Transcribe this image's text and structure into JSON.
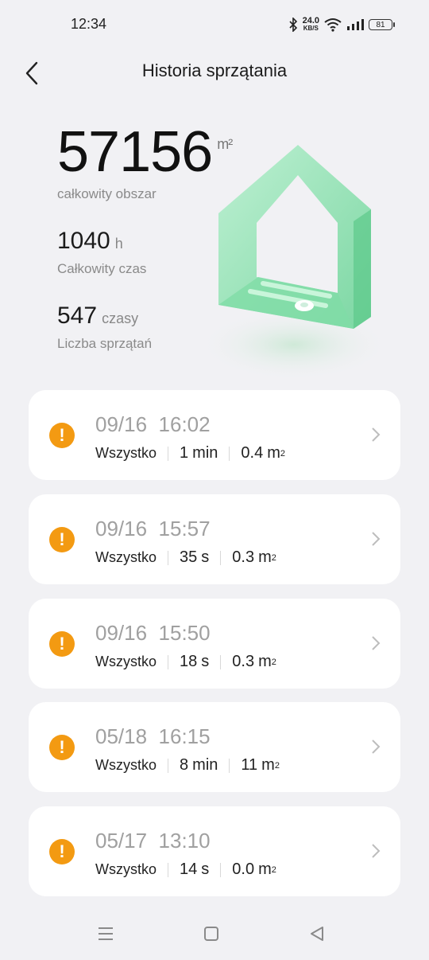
{
  "status": {
    "time": "12:34",
    "speed_value": "24.0",
    "speed_unit": "KB/S",
    "battery": "81"
  },
  "header": {
    "title": "Historia sprzątania"
  },
  "summary": {
    "total_area": "57156",
    "total_area_unit": "m²",
    "total_area_label": "całkowity obszar",
    "total_time": "1040",
    "total_time_unit": "h",
    "total_time_label": "Całkowity czas",
    "count": "547",
    "count_unit": "czasy",
    "count_label": "Liczba sprzątań"
  },
  "records": [
    {
      "date": "09/16",
      "time": "16:02",
      "mode": "Wszystko",
      "duration": "1",
      "duration_unit": "min",
      "area": "0.4",
      "area_unit": "m",
      "area_sup": "2"
    },
    {
      "date": "09/16",
      "time": "15:57",
      "mode": "Wszystko",
      "duration": "35",
      "duration_unit": "s",
      "area": "0.3",
      "area_unit": "m",
      "area_sup": "2"
    },
    {
      "date": "09/16",
      "time": "15:50",
      "mode": "Wszystko",
      "duration": "18",
      "duration_unit": "s",
      "area": "0.3",
      "area_unit": "m",
      "area_sup": "2"
    },
    {
      "date": "05/18",
      "time": "16:15",
      "mode": "Wszystko",
      "duration": "8",
      "duration_unit": "min",
      "area": "11",
      "area_unit": "m",
      "area_sup": "2"
    },
    {
      "date": "05/17",
      "time": "13:10",
      "mode": "Wszystko",
      "duration": "14",
      "duration_unit": "s",
      "area": "0.0",
      "area_unit": "m",
      "area_sup": "2"
    }
  ],
  "colors": {
    "accent_warning": "#f39a12",
    "house_green": "#8fe0b0",
    "background": "#f1f1f4"
  },
  "icons": [
    "back-arrow-icon",
    "warning-icon",
    "chevron-right-icon",
    "bluetooth-icon",
    "wifi-icon",
    "signal-icon",
    "battery-icon",
    "menu-icon",
    "home-square-icon",
    "back-triangle-icon"
  ]
}
